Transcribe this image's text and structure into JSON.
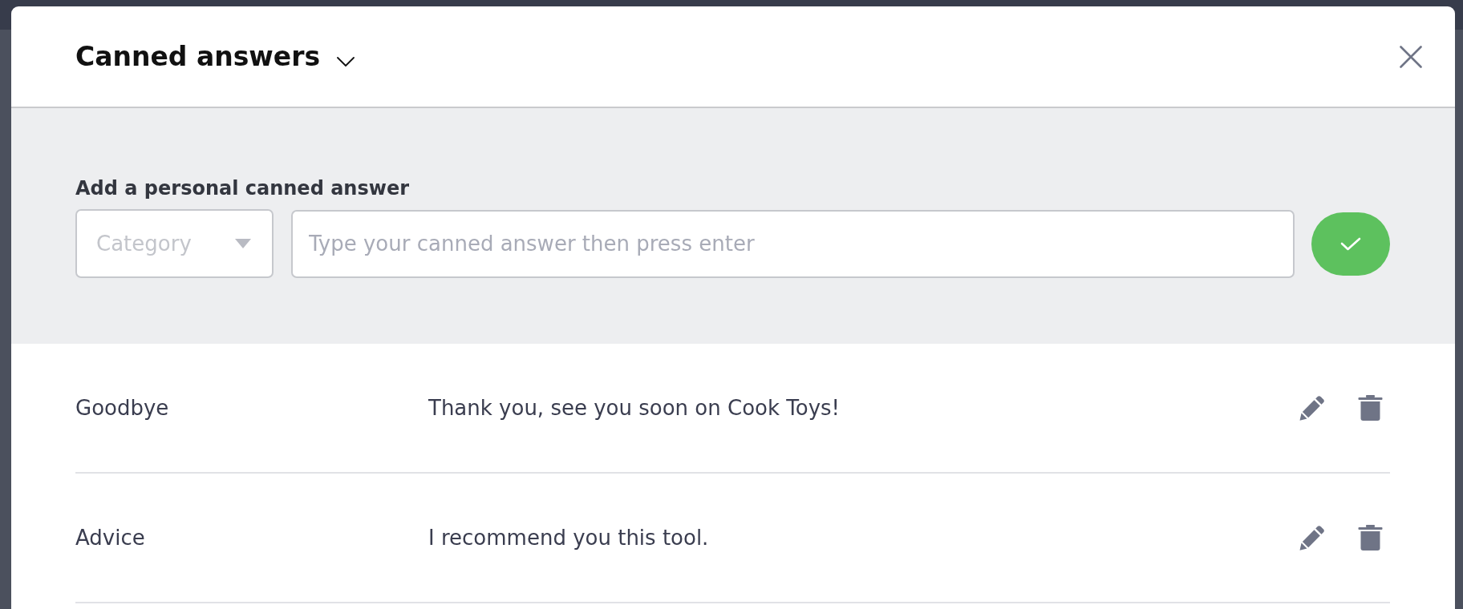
{
  "modal": {
    "title": "Canned answers",
    "form": {
      "label": "Add a personal canned answer",
      "category": {
        "placeholder": "Category"
      },
      "answer": {
        "placeholder": "Type your canned answer then press enter"
      }
    },
    "answers": [
      {
        "category": "Goodbye",
        "text": "Thank you, see you soon on Cook Toys!"
      },
      {
        "category": "Advice",
        "text": "I recommend you this tool."
      }
    ]
  }
}
